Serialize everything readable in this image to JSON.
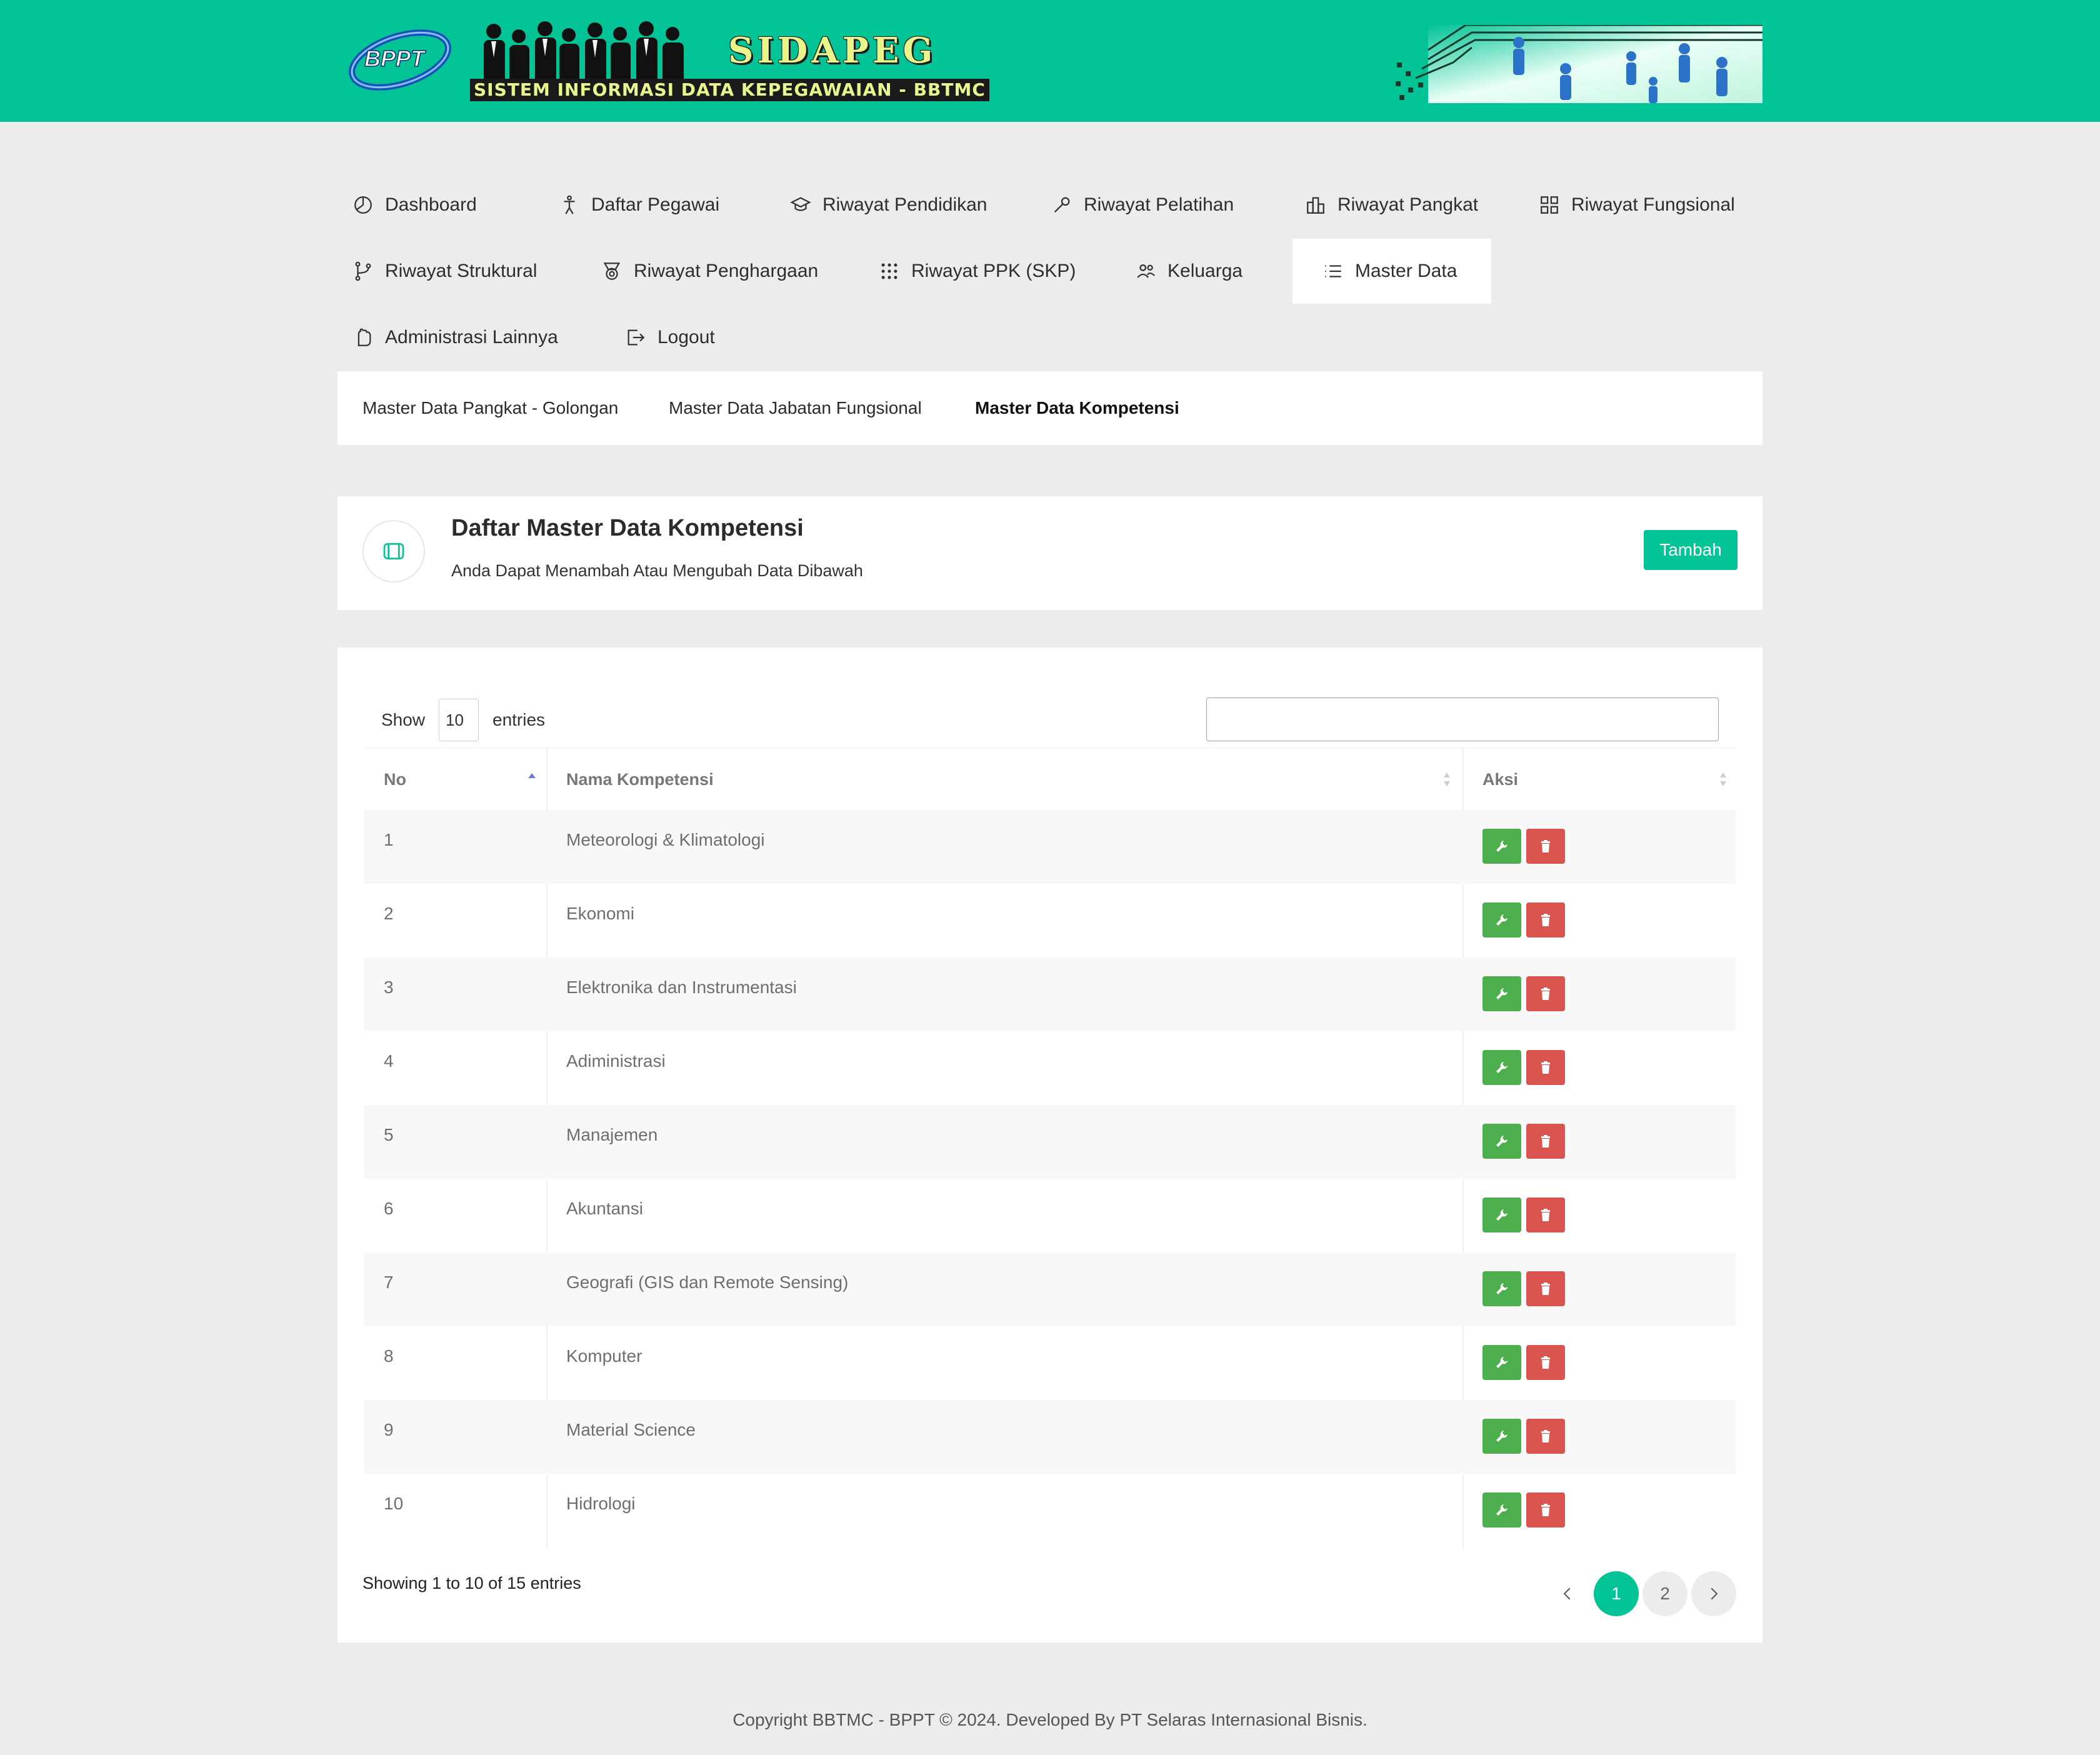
{
  "header": {
    "logo_text": "BPPT",
    "app_name": "SIDAPEG",
    "app_subtitle": "SISTEM INFORMASI DATA KEPEGAWAIAN - BBTMC",
    "brand_color": "#02c396"
  },
  "nav": {
    "items": [
      {
        "label": "Dashboard",
        "icon": "clock-pie-icon"
      },
      {
        "label": "Daftar Pegawai",
        "icon": "person-icon"
      },
      {
        "label": "Riwayat Pendidikan",
        "icon": "graduation-cap-icon"
      },
      {
        "label": "Riwayat Pelatihan",
        "icon": "wrench-icon"
      },
      {
        "label": "Riwayat Pangkat",
        "icon": "building-icon"
      },
      {
        "label": "Riwayat Fungsional",
        "icon": "grid-icon"
      },
      {
        "label": "Riwayat Struktural",
        "icon": "branch-icon"
      },
      {
        "label": "Riwayat Penghargaan",
        "icon": "medal-icon"
      },
      {
        "label": "Riwayat PPK (SKP)",
        "icon": "dots-grid-icon"
      },
      {
        "label": "Keluarga",
        "icon": "users-icon"
      },
      {
        "label": "Master Data",
        "icon": "list-icon",
        "active": true
      },
      {
        "label": "Administrasi Lainnya",
        "icon": "hand-icon"
      },
      {
        "label": "Logout",
        "icon": "logout-icon"
      }
    ]
  },
  "subnav": {
    "items": [
      {
        "label": "Master Data Pangkat - Golongan"
      },
      {
        "label": "Master Data Jabatan Fungsional"
      },
      {
        "label": "Master Data Kompetensi",
        "active": true
      }
    ]
  },
  "page": {
    "title": "Daftar Master Data Kompetensi",
    "subtitle": "Anda Dapat Menambah Atau Mengubah Data Dibawah",
    "add_button": "Tambah"
  },
  "table": {
    "show_label": "Show",
    "entries_value": "10",
    "entries_label": "entries",
    "search_value": "",
    "columns": [
      "No",
      "Nama Kompetensi",
      "Aksi"
    ],
    "rows": [
      {
        "no": "1",
        "nama": "Meteorologi & Klimatologi"
      },
      {
        "no": "2",
        "nama": "Ekonomi"
      },
      {
        "no": "3",
        "nama": "Elektronika dan Instrumentasi"
      },
      {
        "no": "4",
        "nama": "Adiministrasi"
      },
      {
        "no": "5",
        "nama": "Manajemen"
      },
      {
        "no": "6",
        "nama": "Akuntansi"
      },
      {
        "no": "7",
        "nama": "Geografi (GIS dan Remote Sensing)"
      },
      {
        "no": "8",
        "nama": "Komputer"
      },
      {
        "no": "9",
        "nama": "Material Science"
      },
      {
        "no": "10",
        "nama": "Hidrologi"
      }
    ],
    "info": "Showing 1 to 10 of 15 entries",
    "pages": [
      "1",
      "2"
    ],
    "current_page": "1",
    "edit_color": "#4cae4c",
    "delete_color": "#d9534f"
  },
  "footer": {
    "text": "Copyright BBTMC - BPPT © 2024. Developed By PT Selaras Internasional Bisnis."
  }
}
